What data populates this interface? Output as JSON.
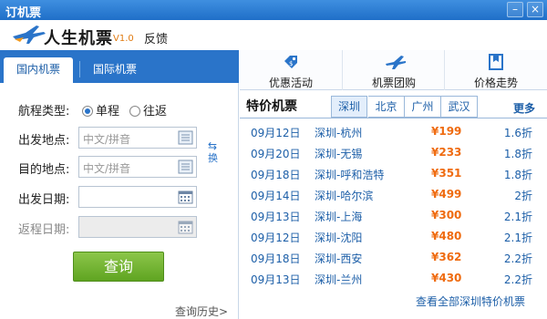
{
  "window": {
    "title": "订机票",
    "minimize": "–",
    "close": "×"
  },
  "header": {
    "logo_text": "人生机票",
    "version": "V1.0",
    "feedback": "反馈"
  },
  "left": {
    "tabs": [
      {
        "label": "国内机票"
      },
      {
        "label": "国际机票"
      }
    ],
    "trip_type_label": "航程类型:",
    "trip_options": [
      {
        "label": "单程",
        "selected": true
      },
      {
        "label": "往返",
        "selected": false
      }
    ],
    "depart_label": "出发地点:",
    "depart_placeholder": "中文/拼音",
    "dest_label": "目的地点:",
    "dest_placeholder": "中文/拼音",
    "swap_label": "换",
    "depart_date_label": "出发日期:",
    "return_date_label": "返程日期:",
    "search_button": "查询",
    "history": "查询历史>"
  },
  "right": {
    "top_links": [
      {
        "label": "优惠活动"
      },
      {
        "label": "机票团购"
      },
      {
        "label": "价格走势"
      }
    ],
    "special_title": "特价机票",
    "city_tabs": [
      {
        "label": "深圳"
      },
      {
        "label": "北京"
      },
      {
        "label": "广州"
      },
      {
        "label": "武汉"
      }
    ],
    "active_city": "深圳",
    "more": "更多",
    "flights": [
      {
        "date": "09月12日",
        "route": "深圳-杭州",
        "price": "¥199",
        "discount": "1.6折"
      },
      {
        "date": "09月20日",
        "route": "深圳-无锡",
        "price": "¥233",
        "discount": "1.8折"
      },
      {
        "date": "09月18日",
        "route": "深圳-呼和浩特",
        "price": "¥351",
        "discount": "1.8折"
      },
      {
        "date": "09月14日",
        "route": "深圳-哈尔滨",
        "price": "¥499",
        "discount": "2折"
      },
      {
        "date": "09月13日",
        "route": "深圳-上海",
        "price": "¥300",
        "discount": "2.1折"
      },
      {
        "date": "09月12日",
        "route": "深圳-沈阳",
        "price": "¥480",
        "discount": "2.1折"
      },
      {
        "date": "09月18日",
        "route": "深圳-西安",
        "price": "¥362",
        "discount": "2.2折"
      },
      {
        "date": "09月13日",
        "route": "深圳-兰州",
        "price": "¥430",
        "discount": "2.2折"
      }
    ],
    "view_all": "查看全部深圳特价机票"
  },
  "colors": {
    "accent": "#2a74c9",
    "price": "#ef6b10",
    "search_button": "#6fb52e"
  }
}
